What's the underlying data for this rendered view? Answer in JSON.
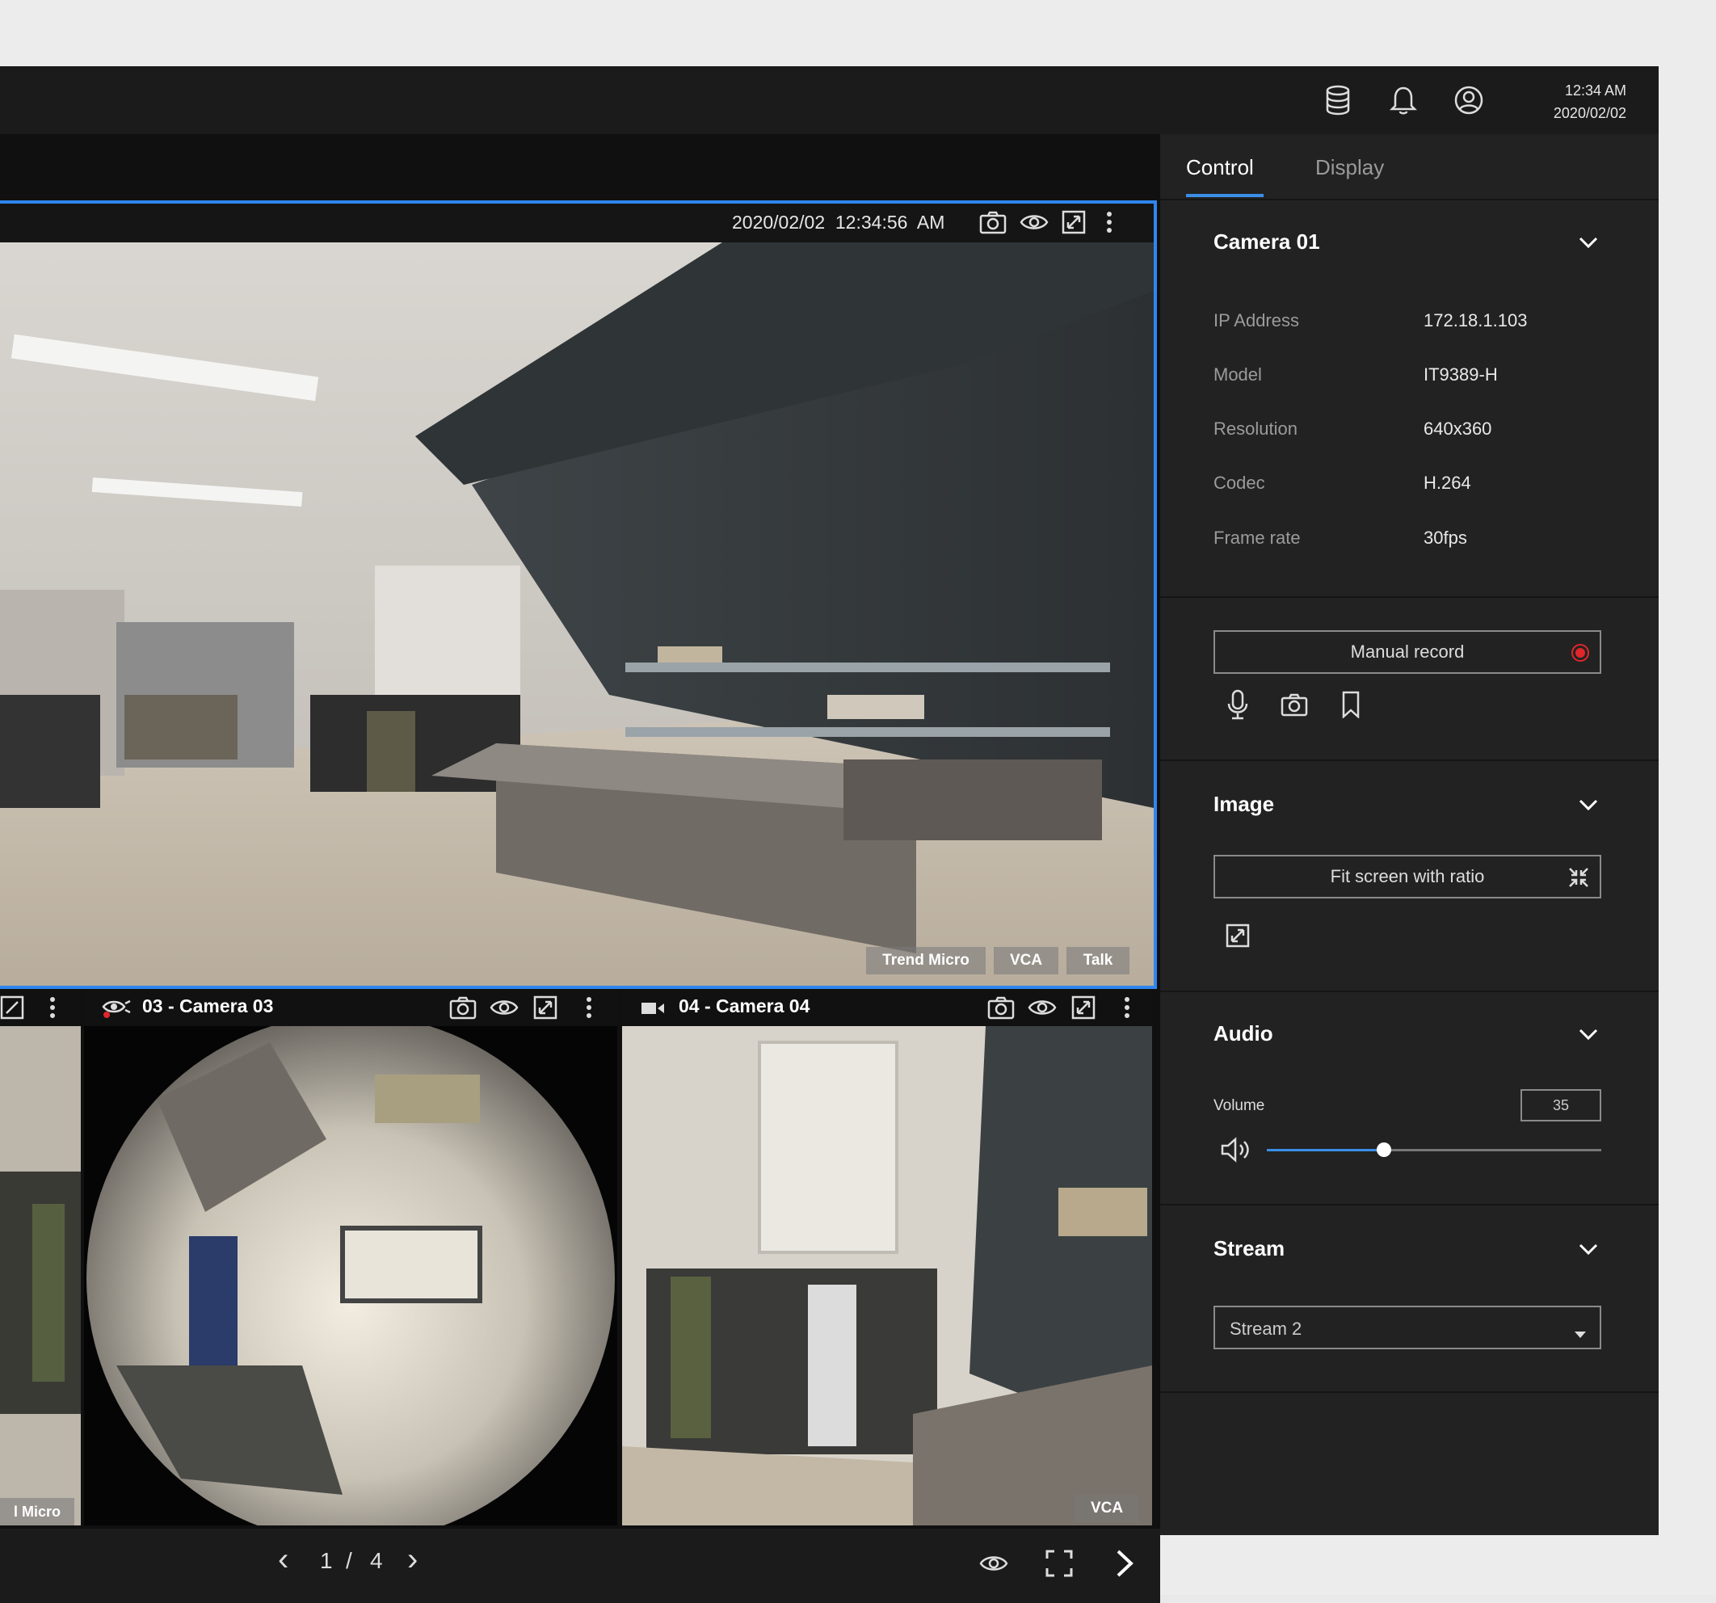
{
  "header": {
    "clock_time": "12:34 AM",
    "clock_date": "2020/02/02",
    "icons": [
      "database-icon",
      "bell-icon",
      "user-icon"
    ]
  },
  "main_camera": {
    "timestamp": "2020/02/02  12:34:56  AM",
    "overlay_buttons": [
      "Trend Micro",
      "VCA",
      "Talk"
    ]
  },
  "tiles": [
    {
      "title": "",
      "overlay": "l Micro"
    },
    {
      "title": "03 - Camera 03",
      "overlay": ""
    },
    {
      "title": "04 - Camera 04",
      "overlay": "VCA"
    }
  ],
  "pager": {
    "prev": "‹",
    "current": "1",
    "separator": "/",
    "total": "4",
    "next": "›"
  },
  "right_panel": {
    "tabs": [
      {
        "label": "Control",
        "active": true
      },
      {
        "label": "Display",
        "active": false
      }
    ],
    "camera_section": {
      "title": "Camera 01",
      "rows": [
        {
          "label": "IP Address",
          "value": "172.18.1.103"
        },
        {
          "label": "Model",
          "value": "IT9389-H"
        },
        {
          "label": "Resolution",
          "value": "640x360"
        },
        {
          "label": "Codec",
          "value": "H.264"
        },
        {
          "label": "Frame rate",
          "value": "30fps"
        }
      ]
    },
    "record_section": {
      "button_label": "Manual record",
      "icons": [
        "microphone-icon",
        "camera-icon",
        "bookmark-icon"
      ]
    },
    "image_section": {
      "title": "Image",
      "button_label": "Fit screen with ratio"
    },
    "audio_section": {
      "title": "Audio",
      "volume_label": "Volume",
      "volume_value": "35",
      "volume_fraction": 0.35
    },
    "stream_section": {
      "title": "Stream",
      "selected": "Stream 2"
    }
  },
  "colors": {
    "accent": "#2f86f0",
    "record": "#e0262a",
    "panel": "#222222",
    "background": "#1c1c1c"
  }
}
